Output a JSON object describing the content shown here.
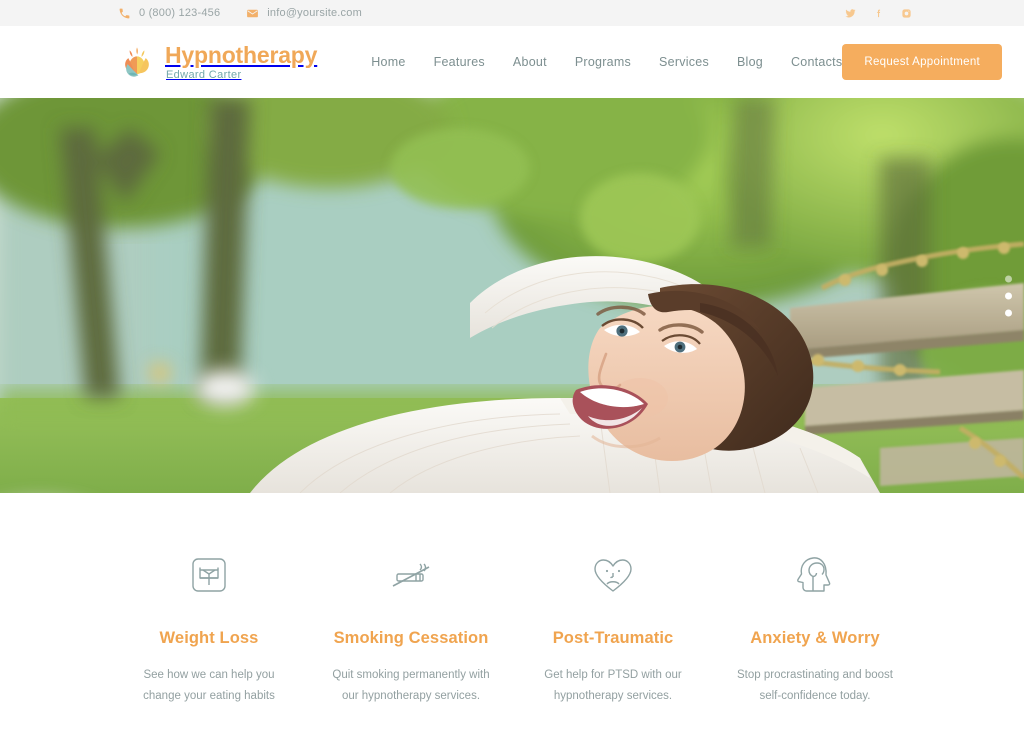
{
  "topbar": {
    "phone": "0 (800) 123-456",
    "email": "info@yoursite.com",
    "phone_icon": "phone-icon",
    "email_icon": "envelope-icon",
    "socials": [
      {
        "name": "twitter-icon",
        "label": "Twitter"
      },
      {
        "name": "facebook-icon",
        "label": "Facebook"
      },
      {
        "name": "instagram-icon",
        "label": "Instagram"
      }
    ],
    "bg_color": "#f4f4f4",
    "icon_color": "#f2b06a"
  },
  "header": {
    "logo": {
      "name": "Hypnotherapy",
      "subtitle": "Edward Carter",
      "mark_icon": "lotus-leaf-logo-icon",
      "name_color": "#f0a858",
      "subtitle_color": "#74a8ab"
    },
    "nav": [
      {
        "label": "Home"
      },
      {
        "label": "Features"
      },
      {
        "label": "About"
      },
      {
        "label": "Programs"
      },
      {
        "label": "Services"
      },
      {
        "label": "Blog"
      },
      {
        "label": "Contacts"
      }
    ],
    "cta": {
      "label": "Request Appointment",
      "bg_color": "#f5ad5e",
      "text_color": "#ffffff"
    }
  },
  "hero": {
    "alt": "Smiling woman relaxing in a wooden hammock in a sunny green garden",
    "slider_dots": [
      {
        "active": false
      },
      {
        "active": true
      },
      {
        "active": true
      }
    ]
  },
  "features": {
    "cards": [
      {
        "icon": "weight-scale-icon",
        "title": "Weight Loss",
        "desc": "See how we can help you change your eating habits"
      },
      {
        "icon": "no-smoking-icon",
        "title": "Smoking Cessation",
        "desc": "Quit smoking permanently with our hypnotherapy services."
      },
      {
        "icon": "sad-heart-icon",
        "title": "Post-Traumatic",
        "desc": "Get help for PTSD with our hypnotherapy services."
      },
      {
        "icon": "head-brain-icon",
        "title": "Anxiety & Worry",
        "desc": "Stop procrastinating and boost self-confidence today."
      }
    ],
    "title_color": "#f0a44f",
    "icon_color": "#8fa3a4"
  }
}
